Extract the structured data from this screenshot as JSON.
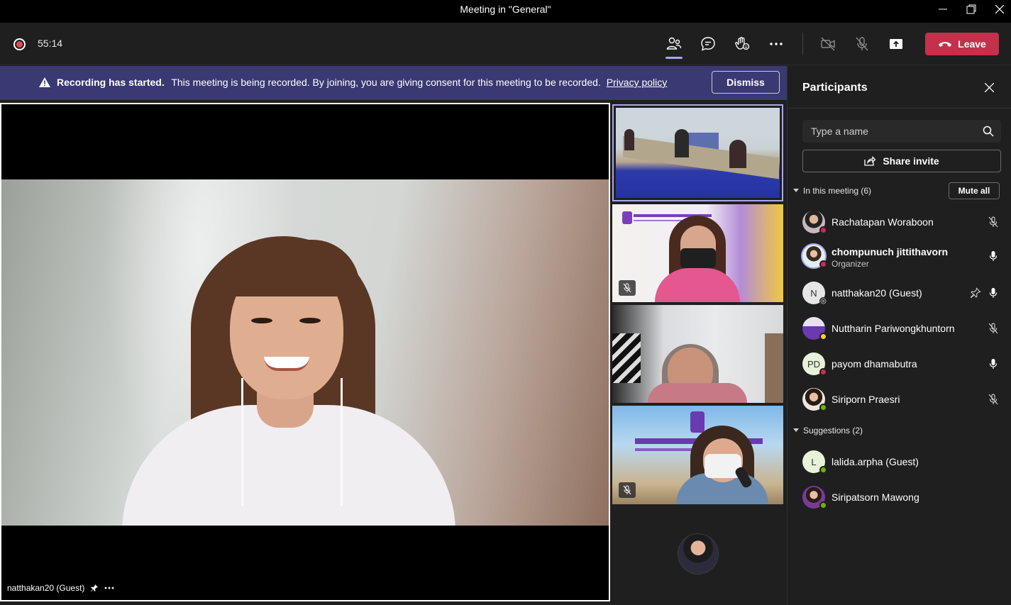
{
  "window": {
    "title": "Meeting in \"General\""
  },
  "toolbar": {
    "timer": "55:14",
    "leave_label": "Leave"
  },
  "banner": {
    "title": "Recording has started.",
    "message": "This meeting is being recorded. By joining, you are giving consent for this meeting to be recorded.",
    "link": "Privacy policy",
    "dismiss_label": "Dismiss"
  },
  "stage": {
    "speaker_name": "natthakan20 (Guest)"
  },
  "panel": {
    "title": "Participants",
    "search_placeholder": "Type a name",
    "share_label": "Share invite",
    "in_meeting_label": "In this meeting (6)",
    "mute_all_label": "Mute all",
    "suggestions_label": "Suggestions (2)",
    "participants": [
      {
        "name": "Rachatapan Woraboon",
        "role": "",
        "initials": "",
        "mic": "muted"
      },
      {
        "name": "chompunuch jittithavorn",
        "role": "Organizer",
        "initials": "",
        "mic": "on"
      },
      {
        "name": "natthakan20 (Guest)",
        "role": "",
        "initials": "N",
        "mic": "on"
      },
      {
        "name": "Nuttharin Pariwongkhuntorn",
        "role": "",
        "initials": "",
        "mic": "muted"
      },
      {
        "name": "payom dhamabutra",
        "role": "",
        "initials": "PD",
        "mic": "on"
      },
      {
        "name": "Siriporn Praesri",
        "role": "",
        "initials": "",
        "mic": "muted"
      }
    ],
    "suggestions": [
      {
        "name": "lalida.arpha (Guest)",
        "initials": "L"
      },
      {
        "name": "Siripatsorn Mawong",
        "initials": ""
      }
    ]
  },
  "colors": {
    "accent": "#a8a6f0",
    "leave": "#c4314b",
    "banner": "#393973",
    "available": "#6bb700",
    "busy": "#c4314b",
    "away": "#f8d22a"
  }
}
